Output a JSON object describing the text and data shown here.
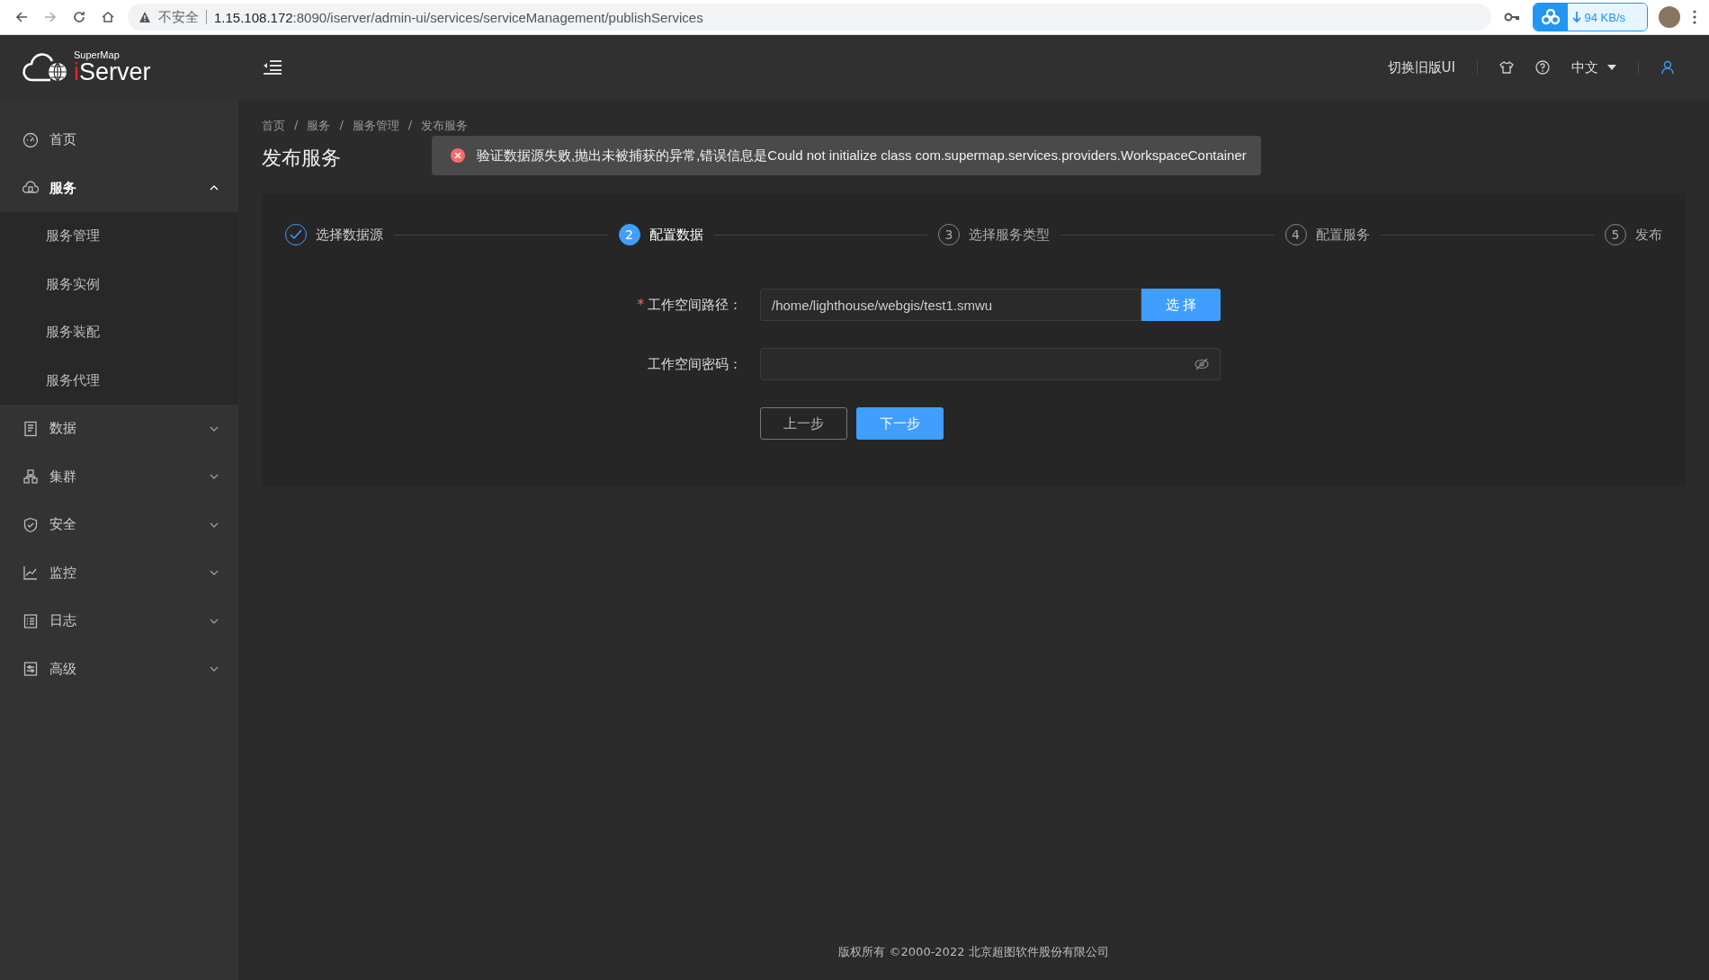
{
  "browser": {
    "security": "不安全",
    "url_host": "1.15.108.172",
    "url_rest": ":8090/iserver/admin-ui/services/serviceManagement/publishServices",
    "download_speed": "94 KB/s"
  },
  "logo": {
    "small": "SuperMap",
    "first": "i",
    "rest": "Server"
  },
  "header": {
    "switch_ui": "切换旧版UI",
    "language": "中文"
  },
  "sidebar": {
    "items": [
      {
        "label": "首页",
        "selected": false
      },
      {
        "label": "服务",
        "selected": true,
        "expanded": true,
        "children": [
          {
            "label": "服务管理",
            "selected": false
          },
          {
            "label": "服务实例",
            "selected": false
          },
          {
            "label": "服务装配",
            "selected": false
          },
          {
            "label": "服务代理",
            "selected": false
          }
        ]
      },
      {
        "label": "数据",
        "selected": false,
        "expanded": false
      },
      {
        "label": "集群",
        "selected": false,
        "expanded": false
      },
      {
        "label": "安全",
        "selected": false,
        "expanded": false
      },
      {
        "label": "监控",
        "selected": false,
        "expanded": false
      },
      {
        "label": "日志",
        "selected": false,
        "expanded": false
      },
      {
        "label": "高级",
        "selected": false,
        "expanded": false
      }
    ]
  },
  "breadcrumb": {
    "separator": "/",
    "items": [
      "首页",
      "服务",
      "服务管理",
      "发布服务"
    ]
  },
  "page_title": "发布服务",
  "toast": {
    "kind": "error",
    "message": "验证数据源失败,抛出未被捕获的异常,错误信息是Could not initialize class com.supermap.services.providers.WorkspaceContainer"
  },
  "steps": [
    {
      "label": "选择数据源",
      "done": true,
      "selected": false
    },
    {
      "number": "2",
      "label": "配置数据",
      "done": false,
      "selected": true
    },
    {
      "number": "3",
      "label": "选择服务类型",
      "done": false,
      "selected": false
    },
    {
      "number": "4",
      "label": "配置服务",
      "done": false,
      "selected": false
    },
    {
      "number": "5",
      "label": "发布",
      "done": false,
      "selected": false
    }
  ],
  "form": {
    "fields": [
      {
        "label": "工作空间路径：",
        "required_mark": "*",
        "kind": "path",
        "value": "/home/lighthouse/webgis/test1.smwu",
        "button": "选 择"
      },
      {
        "label": "工作空间密码：",
        "kind": "password"
      }
    ],
    "prev_button": "上一步",
    "next_button": "下一步"
  },
  "footer": "版权所有 ©2000-2022 北京超图软件股份有限公司"
}
